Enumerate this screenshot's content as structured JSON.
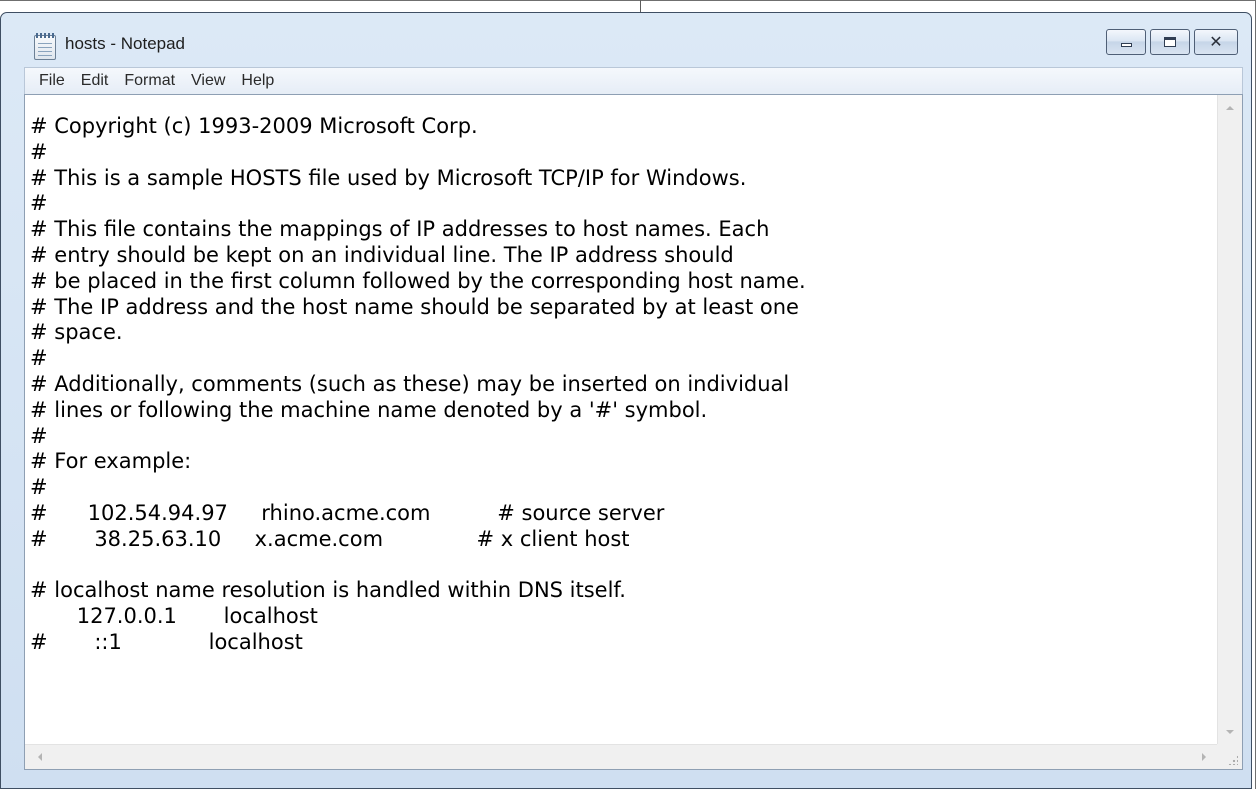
{
  "window": {
    "title": "hosts - Notepad"
  },
  "menu": {
    "items": [
      "File",
      "Edit",
      "Format",
      "View",
      "Help"
    ]
  },
  "document": {
    "lines": [
      "# Copyright (c) 1993-2009 Microsoft Corp.",
      "#",
      "# This is a sample HOSTS file used by Microsoft TCP/IP for Windows.",
      "#",
      "# This file contains the mappings of IP addresses to host names. Each",
      "# entry should be kept on an individual line. The IP address should",
      "# be placed in the first column followed by the corresponding host name.",
      "# The IP address and the host name should be separated by at least one",
      "# space.",
      "#",
      "# Additionally, comments (such as these) may be inserted on individual",
      "# lines or following the machine name denoted by a '#' symbol.",
      "#",
      "# For example:",
      "#",
      "#      102.54.94.97     rhino.acme.com          # source server",
      "#       38.25.63.10     x.acme.com              # x client host",
      "",
      "# localhost name resolution is handled within DNS itself.",
      "       127.0.0.1       localhost",
      "#       ::1             localhost"
    ]
  },
  "icons": {
    "app": "notepad-icon",
    "minimize": "minimize-icon",
    "maximize": "maximize-icon",
    "close": "close-icon"
  },
  "colors": {
    "titlebar": "#d6e5f5",
    "editor_bg": "#ffffff",
    "text": "#000000"
  }
}
